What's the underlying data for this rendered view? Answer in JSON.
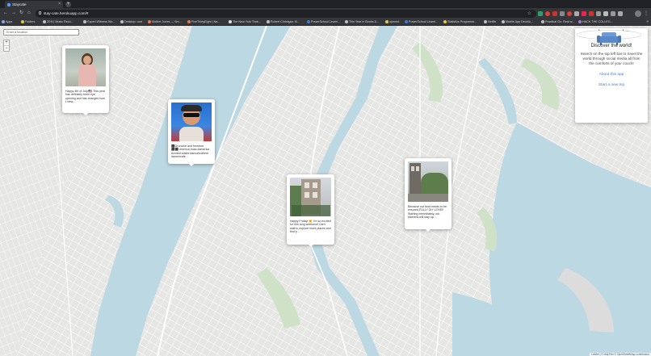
{
  "browser": {
    "tab_title": "Staycate",
    "url": "stay-cate.herokuapp.com/#",
    "bookmarks": [
      {
        "label": "Apps",
        "color": "#7aa7f7"
      },
      {
        "label": "Folders",
        "color": "#e6c24a"
      },
      {
        "label": "ZEN | Music Reco...",
        "color": "#bbbbbb"
      },
      {
        "label": "Expert Witness Wo...",
        "color": "#bbbbbb"
      },
      {
        "label": "Desktop: root",
        "color": "#bbbbbb"
      },
      {
        "label": "Mother Jones — Sm...",
        "color": "#e8744a"
      },
      {
        "label": "FiveThirtyEight | Na...",
        "color": "#e8744a"
      },
      {
        "label": "The New York Time...",
        "color": "#dddddd"
      },
      {
        "label": "Robert Christgau: Ki...",
        "color": "#bbbbbb"
      },
      {
        "label": "PowerSchool Learni...",
        "color": "#3a7bd5"
      },
      {
        "label": "This Year in Books &...",
        "color": "#bbbbbb"
      },
      {
        "label": "opened",
        "color": "#e6c24a"
      },
      {
        "label": "PowerSchool Learni...",
        "color": "#3a7bd5"
      },
      {
        "label": "Statistics Programm...",
        "color": "#e6c24a"
      },
      {
        "label": "Netflix",
        "color": "#bbbbbb"
      },
      {
        "label": "Mobile App Develo...",
        "color": "#bbbbbb"
      },
      {
        "label": "Practical Go: Real w...",
        "color": "#bbbbbb"
      },
      {
        "label": "HACK THE COLLEG...",
        "color": "#9a7bd5"
      }
    ]
  },
  "map": {
    "search_placeholder": "Enter a location",
    "zoom_in": "+",
    "zoom_out": "−",
    "attribution": "Leaflet | © MapTiler © OpenStreetMap contributors"
  },
  "popups": [
    {
      "caption": "Happy 4th of July!🇺🇸 This year has definitely been eye opening and has changed how I view...",
      "photo": "woman-portrait"
    },
    {
      "caption": "⬛Grunchie and freedom ⬛⬛ #merica #usa #america #united states #amurlicahere #americafe...",
      "photo": "woman-sunglasses"
    },
    {
      "caption": "Happy Friday! 🌞 I'm so excited for this long weekend! Can't wait to explore more places and find p...",
      "photo": "brownstone"
    },
    {
      "caption": "Because our food needs to be ensured FULLY DIY LOVE!! Starting immediately, our kitchens will stay op...",
      "photo": "building"
    }
  ],
  "panel": {
    "brand": "staycate",
    "heading": "Discover the world!",
    "description": "Search on the top left bar to travel the world through social media all from the comforts of your couch!",
    "about_link": "About this app",
    "new_trip_link": "Start a new trip"
  }
}
